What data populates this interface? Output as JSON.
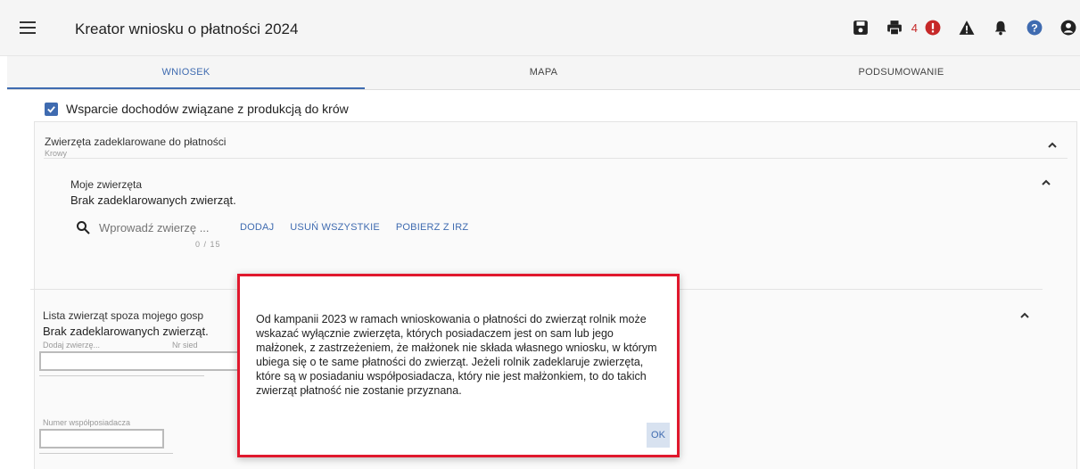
{
  "header": {
    "title": "Kreator wniosku o płatności 2024",
    "error_count": "4",
    "icons": [
      "menu-icon",
      "save-icon",
      "print-icon",
      "error-icon",
      "warning-icon",
      "bell-icon",
      "help-icon",
      "user-icon"
    ]
  },
  "tabs": [
    {
      "label": "WNIOSEK",
      "active": true
    },
    {
      "label": "MAPA",
      "active": false
    },
    {
      "label": "PODSUMOWANIE",
      "active": false
    }
  ],
  "support": {
    "label": "Wsparcie dochodów związane z produkcją do krów",
    "checked": true
  },
  "animals_panel": {
    "title": "Zwierzęta zadeklarowane do płatności",
    "subtitle": "Krowy"
  },
  "my_animals": {
    "title": "Moje zwierzęta",
    "empty": "Brak zadeklarowanych zwierząt.",
    "search_placeholder": "Wprowadź zwierzę ...",
    "counter": "0 / 15",
    "add": "DODAJ",
    "remove_all": "USUŃ WSZYSTKIE",
    "fetch": "POBIERZ Z IRZ"
  },
  "other_animals": {
    "title": "Lista zwierząt spoza mojego gosp",
    "empty": "Brak zadeklarowanych zwierząt.",
    "add_label": "Dodaj zwierzę...",
    "nr_label": "Nr sied",
    "coowner_label": "Numer współposiadacza"
  },
  "dialog": {
    "message": "Od kampanii 2023 w ramach wnioskowania o płatności do zwierząt rolnik może wskazać wyłącznie zwierzęta, których posiadaczem jest on sam lub jego małżonek, z zastrzeżeniem, że małżonek nie składa własnego wniosku, w którym ubiega się o te same płatności do zwierząt. Jeżeli rolnik zadeklaruje zwierzęta, które są w posiadaniu współposiadacza, który nie jest małżonkiem, to do takich zwierząt płatność nie zostanie przyznana.",
    "ok": "OK"
  },
  "colors": {
    "accent": "#3f6bb0",
    "error": "#c62828",
    "dialog_border": "#e0182d"
  }
}
